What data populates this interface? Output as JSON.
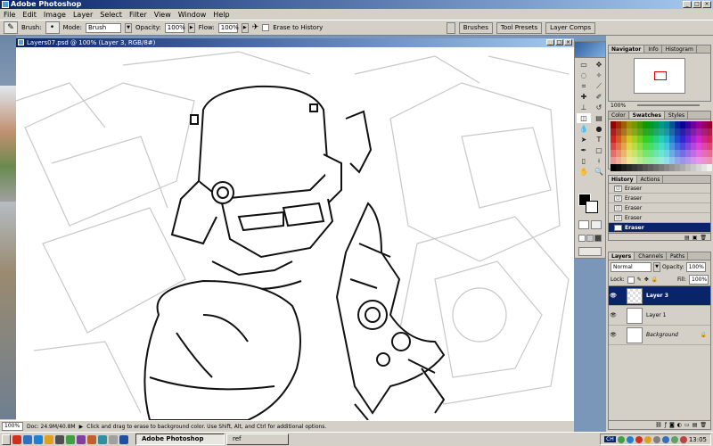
{
  "app": {
    "title": "Adobe Photoshop"
  },
  "menu": [
    "File",
    "Edit",
    "Image",
    "Layer",
    "Select",
    "Filter",
    "View",
    "Window",
    "Help"
  ],
  "options": {
    "brush_label": "Brush:",
    "mode_label": "Mode:",
    "mode_value": "Brush",
    "opacity_label": "Opacity:",
    "opacity_value": "100%",
    "flow_label": "Flow:",
    "flow_value": "100%",
    "erase_history_label": "Erase to History",
    "wells": [
      "Brushes",
      "Tool Presets",
      "Layer Comps"
    ]
  },
  "document": {
    "title": "Layers07.psd @ 100% (Layer 3, RGB/8#)"
  },
  "navigator": {
    "tabs": [
      "Navigator",
      "Info",
      "Histogram"
    ],
    "zoom": "100%"
  },
  "swatches": {
    "tabs": [
      "Color",
      "Swatches",
      "Styles"
    ]
  },
  "history": {
    "tabs": [
      "History",
      "Actions"
    ],
    "items": [
      "Eraser",
      "Eraser",
      "Eraser",
      "Eraser",
      "Eraser"
    ],
    "selected_index": 4
  },
  "layers": {
    "tabs": [
      "Layers",
      "Channels",
      "Paths"
    ],
    "blend_mode": "Normal",
    "opacity_label": "Opacity:",
    "opacity_value": "100%",
    "lock_label": "Lock:",
    "fill_label": "Fill:",
    "fill_value": "100%",
    "items": [
      {
        "name": "Layer 3",
        "selected": true
      },
      {
        "name": "Layer 1",
        "selected": false
      },
      {
        "name": "Background",
        "selected": false
      }
    ]
  },
  "status": {
    "zoom": "100%",
    "doc": "Doc: 24.9M/40.8M",
    "hint": "Click and drag to erase to background color.  Use Shift, Alt, and Ctrl for additional options."
  },
  "taskbar": {
    "items": [
      {
        "label": "Adobe Photoshop",
        "active": true
      },
      {
        "label": "ref",
        "active": false
      }
    ],
    "tray_lang": "CH",
    "clock": "13:05"
  },
  "colors": {
    "titlebar": "#0a246a",
    "chrome": "#d4d0c8",
    "desktop": "#7a96b8",
    "selection": "#0a246a"
  }
}
